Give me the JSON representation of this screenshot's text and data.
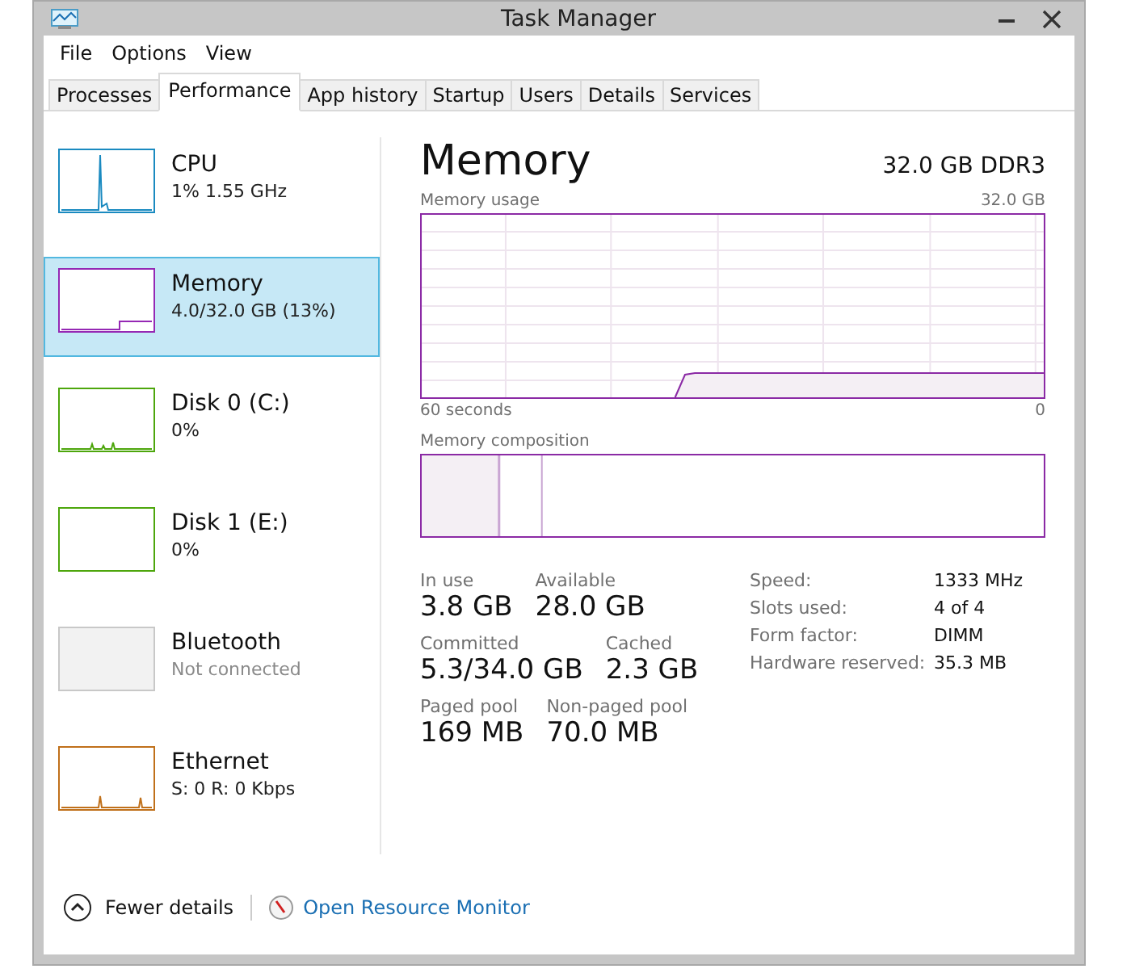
{
  "window": {
    "title": "Task Manager"
  },
  "menu": [
    "File",
    "Options",
    "View"
  ],
  "tabs": [
    {
      "label": "Processes",
      "selected": false
    },
    {
      "label": "Performance",
      "selected": true
    },
    {
      "label": "App history",
      "selected": false
    },
    {
      "label": "Startup",
      "selected": false
    },
    {
      "label": "Users",
      "selected": false
    },
    {
      "label": "Details",
      "selected": false
    },
    {
      "label": "Services",
      "selected": false
    }
  ],
  "sidebar": {
    "items": [
      {
        "name": "CPU",
        "detail": "1% 1.55 GHz",
        "color": "#1a8ac0",
        "selected": false,
        "disabled": false
      },
      {
        "name": "Memory",
        "detail": "4.0/32.0 GB (13%)",
        "color": "#9528b4",
        "selected": true,
        "disabled": false
      },
      {
        "name": "Disk 0 (C:)",
        "detail": "0%",
        "color": "#4da60c",
        "selected": false,
        "disabled": false
      },
      {
        "name": "Disk 1 (E:)",
        "detail": "0%",
        "color": "#4da60c",
        "selected": false,
        "disabled": false
      },
      {
        "name": "Bluetooth",
        "detail": "Not connected",
        "color": "#c8c8c8",
        "selected": false,
        "disabled": true
      },
      {
        "name": "Ethernet",
        "detail": "S: 0 R: 0 Kbps",
        "color": "#c0701a",
        "selected": false,
        "disabled": false
      }
    ]
  },
  "detail": {
    "title": "Memory",
    "subtitle": "32.0 GB DDR3",
    "usage_chart": {
      "label": "Memory usage",
      "max": "32.0 GB",
      "x_start": "60 seconds",
      "x_end": "0"
    },
    "composition": {
      "label": "Memory composition"
    },
    "stats": [
      [
        {
          "label": "In use",
          "value": "3.8 GB"
        },
        {
          "label": "Available",
          "value": "28.0 GB"
        }
      ],
      [
        {
          "label": "Committed",
          "value": "5.3/34.0 GB"
        },
        {
          "label": "Cached",
          "value": "2.3 GB"
        }
      ],
      [
        {
          "label": "Paged pool",
          "value": "169 MB"
        },
        {
          "label": "Non-paged pool",
          "value": "70.0 MB"
        }
      ]
    ],
    "properties": [
      {
        "label": "Speed:",
        "value": "1333 MHz"
      },
      {
        "label": "Slots used:",
        "value": "4 of 4"
      },
      {
        "label": "Form factor:",
        "value": "DIMM"
      },
      {
        "label": "Hardware reserved:",
        "value": "35.3 MB"
      }
    ]
  },
  "footer": {
    "fewer_details": "Fewer details",
    "resource_monitor": "Open Resource Monitor"
  }
}
